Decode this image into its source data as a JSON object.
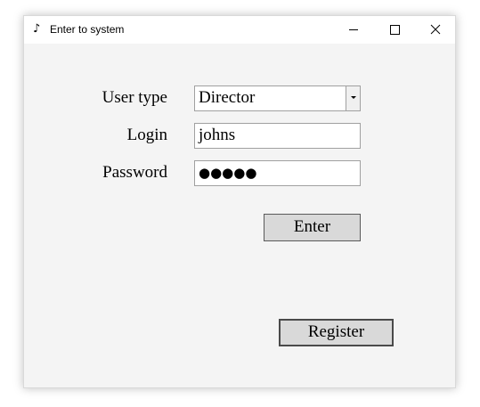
{
  "window": {
    "title": "Enter to system",
    "icon": "music-note-icon",
    "app_icon_glyph": "♪",
    "controls": [
      "minimize-icon",
      "maximize-icon",
      "close-icon"
    ]
  },
  "form": {
    "user_type_label": "User type",
    "user_type_value": "Director",
    "login_label": "Login",
    "login_value": "johns",
    "password_label": "Password",
    "password_masked": "●●●●●"
  },
  "buttons": {
    "enter_label": "Enter",
    "register_label": "Register"
  },
  "colors": {
    "window_bg": "#f4f4f4",
    "titlebar_bg": "#ffffff",
    "button_bg": "#d9d9d9"
  }
}
